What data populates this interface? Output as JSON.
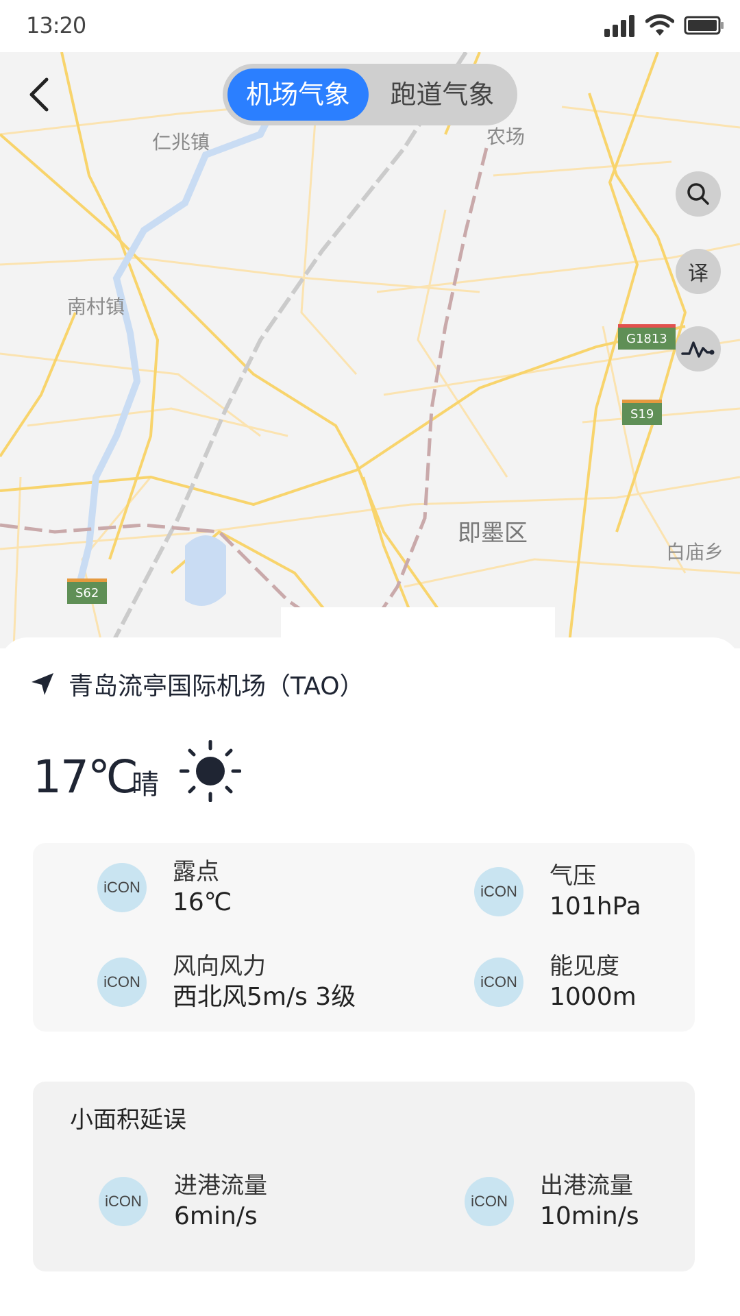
{
  "status_bar": {
    "time": "13:20"
  },
  "map": {
    "labels": {
      "renzhao": "仁兆镇",
      "nongchang": "农场",
      "nancun": "南村镇",
      "jimo": "即墨区",
      "baimiao": "白庙乡"
    },
    "shields": {
      "g1813": "G1813",
      "s19": "S19",
      "s62": "S62"
    }
  },
  "segment": {
    "tab_airport": "机场气象",
    "tab_runway": "跑道气象"
  },
  "fabs": {
    "translate_label": "译"
  },
  "airport": {
    "name": "青岛流亭国际机场（TAO）"
  },
  "weather": {
    "temperature": "17℃",
    "condition": "晴",
    "metrics": {
      "dew_label": "露点",
      "dew_value": "16℃",
      "pressure_label": "气压",
      "pressure_value": "101hPa",
      "wind_label": "风向风力",
      "wind_value": "西北风5m/s 3级",
      "visibility_label": "能见度",
      "visibility_value": "1000m"
    }
  },
  "delay": {
    "title": "小面积延误",
    "arrival_label": "进港流量",
    "arrival_value": "6min/s",
    "departure_label": "出港流量",
    "departure_value": "10min/s"
  },
  "icon_placeholder": "iCON",
  "colors": {
    "accent": "#2b7fff",
    "icon_bg": "#c9e4f1",
    "dark": "#1f2533"
  }
}
